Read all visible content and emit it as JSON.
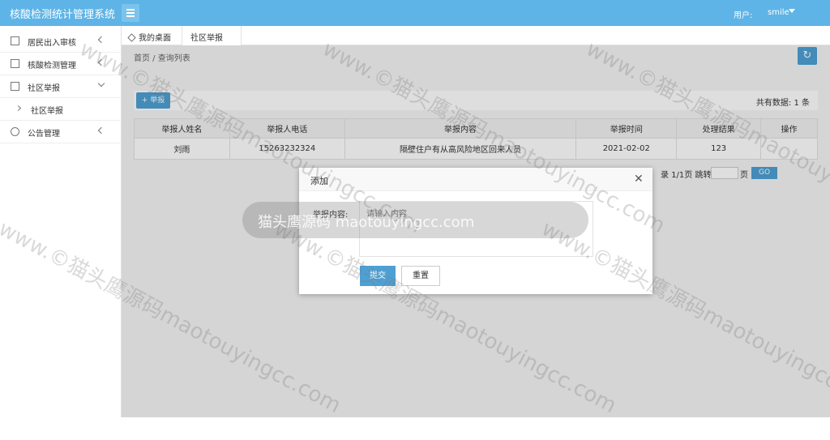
{
  "app": {
    "title": "核酸检测统计管理系统",
    "user_label": "用户:",
    "user_name": "smile"
  },
  "sidebar": {
    "items": [
      {
        "label": "居民出入审核"
      },
      {
        "label": "核酸检测管理"
      },
      {
        "label": "社区举报"
      },
      {
        "label": "社区举报"
      },
      {
        "label": "公告管理"
      }
    ]
  },
  "tabs": {
    "home": "我的桌面",
    "active": "社区举报",
    "close": "×"
  },
  "breadcrumb": "首页 / 查询列表",
  "refresh_icon": "↻",
  "toolbar": {
    "add_label": "+ 举报",
    "total": "共有数据: 1 条"
  },
  "table": {
    "headers": [
      "举报人姓名",
      "举报人电话",
      "举报内容",
      "举报时间",
      "处理结果",
      "操作"
    ],
    "rows": [
      [
        "刘雨",
        "15263232324",
        "隔壁住户有从高风险地区回来人员",
        "2021-02-02",
        "123",
        ""
      ]
    ]
  },
  "pager": {
    "text": "录 1/1页 跳转至",
    "page_suffix": "页",
    "go": "GO"
  },
  "modal": {
    "title": "添加",
    "close": "✕",
    "field_label": "举报内容:",
    "placeholder": "请输入内容",
    "submit": "提交",
    "reset": "重置"
  },
  "watermark": {
    "text": "www.©猫头鹰源码maotouyingcc.com",
    "bar_text": "猫头鹰源码 maotouyingcc.com"
  },
  "colors": {
    "topbar": "#5eb4e6",
    "primary_button": "#4ea0d4"
  }
}
